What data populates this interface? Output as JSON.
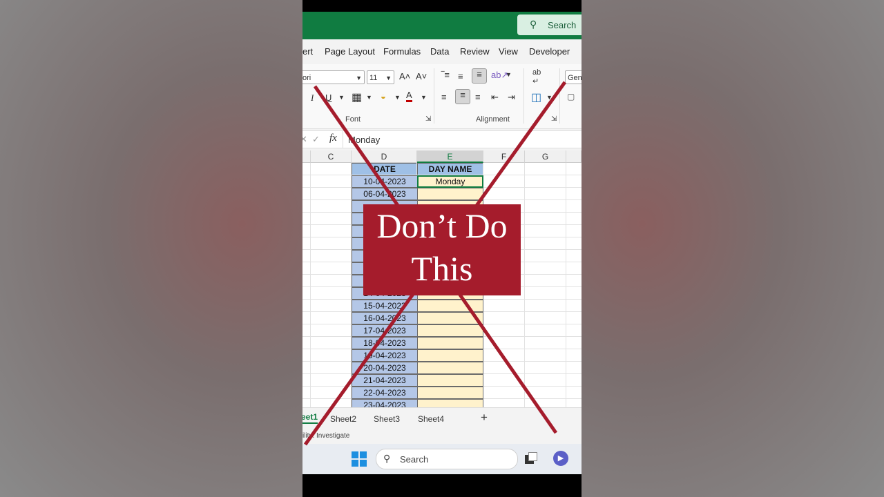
{
  "app": {
    "search_label": "Search",
    "ribbon_tabs": [
      "ert",
      "Page Layout",
      "Formulas",
      "Data",
      "Review",
      "View",
      "Developer"
    ]
  },
  "ribbon": {
    "font_name": "ori",
    "font_size": "11",
    "number_format": "Gene",
    "group_font": "Font",
    "group_alignment": "Alignment",
    "font_color": "#c00000"
  },
  "formula_bar": {
    "fx_label": "fx",
    "value": "Monday"
  },
  "grid": {
    "columns": [
      "C",
      "D",
      "E",
      "F",
      "G"
    ],
    "selected_column": "E",
    "header_date": "DATE",
    "header_day": "DAY NAME",
    "rows": [
      {
        "date": "10-04-2023",
        "day": "Monday"
      },
      {
        "date": "06-04-2023",
        "day": ""
      },
      {
        "date": "",
        "day": ""
      },
      {
        "date": "",
        "day": ""
      },
      {
        "date": "",
        "day": ""
      },
      {
        "date": "",
        "day": ""
      },
      {
        "date": "",
        "day": ""
      },
      {
        "date": "",
        "day": ""
      },
      {
        "date": "",
        "day": ""
      },
      {
        "date": "14-04-2023",
        "day": ""
      },
      {
        "date": "15-04-2023",
        "day": ""
      },
      {
        "date": "16-04-2023",
        "day": ""
      },
      {
        "date": "17-04-2023",
        "day": ""
      },
      {
        "date": "18-04-2023",
        "day": ""
      },
      {
        "date": "19-04-2023",
        "day": ""
      },
      {
        "date": "20-04-2023",
        "day": ""
      },
      {
        "date": "21-04-2023",
        "day": ""
      },
      {
        "date": "22-04-2023",
        "day": ""
      },
      {
        "date": "23-04-2023",
        "day": ""
      }
    ],
    "header_fill": "#9fc0e6",
    "day_fill": "#fff2cc"
  },
  "sheets": {
    "tabs": [
      "eet1",
      "Sheet2",
      "Sheet3",
      "Sheet4"
    ],
    "add_label": "+"
  },
  "status_text": "ility: Investigate",
  "taskbar": {
    "search_label": "Search"
  },
  "overlay": {
    "line1": "Don’t Do",
    "line2": "This",
    "color": "#a51c2c"
  }
}
